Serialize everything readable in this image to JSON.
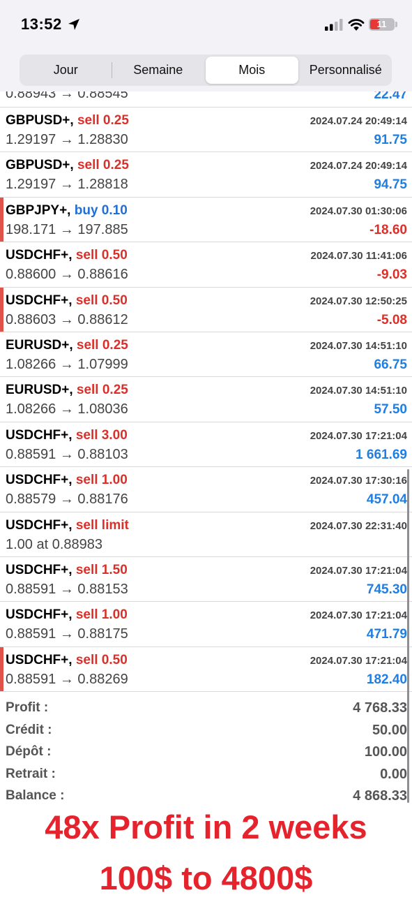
{
  "status_bar": {
    "time": "13:52",
    "battery": "11"
  },
  "tabs": [
    {
      "label": "Jour",
      "active": false
    },
    {
      "label": "Semaine",
      "active": false
    },
    {
      "label": "Mois",
      "active": true
    },
    {
      "label": "Personnalisé",
      "active": false
    }
  ],
  "first_row_partial": {
    "prices": "0.88943 → 0.88545",
    "profit": "22.47"
  },
  "trades": [
    {
      "symbol": "GBPUSD+,",
      "side": "sell 0.25",
      "side_type": "sell",
      "time": "2024.07.24 20:49:14",
      "prices": "1.29197 → 1.28830",
      "profit": "91.75",
      "profit_sign": "pos",
      "marker": false
    },
    {
      "symbol": "GBPUSD+,",
      "side": "sell 0.25",
      "side_type": "sell",
      "time": "2024.07.24 20:49:14",
      "prices": "1.29197 → 1.28818",
      "profit": "94.75",
      "profit_sign": "pos",
      "marker": false
    },
    {
      "symbol": "GBPJPY+,",
      "side": "buy 0.10",
      "side_type": "buy",
      "time": "2024.07.30 01:30:06",
      "prices": "198.171 → 197.885",
      "profit": "-18.60",
      "profit_sign": "neg",
      "marker": true
    },
    {
      "symbol": "USDCHF+,",
      "side": "sell 0.50",
      "side_type": "sell",
      "time": "2024.07.30 11:41:06",
      "prices": "0.88600 → 0.88616",
      "profit": "-9.03",
      "profit_sign": "neg",
      "marker": false
    },
    {
      "symbol": "USDCHF+,",
      "side": "sell 0.50",
      "side_type": "sell",
      "time": "2024.07.30 12:50:25",
      "prices": "0.88603 → 0.88612",
      "profit": "-5.08",
      "profit_sign": "neg",
      "marker": true
    },
    {
      "symbol": "EURUSD+,",
      "side": "sell 0.25",
      "side_type": "sell",
      "time": "2024.07.30 14:51:10",
      "prices": "1.08266 → 1.07999",
      "profit": "66.75",
      "profit_sign": "pos",
      "marker": false
    },
    {
      "symbol": "EURUSD+,",
      "side": "sell 0.25",
      "side_type": "sell",
      "time": "2024.07.30 14:51:10",
      "prices": "1.08266 → 1.08036",
      "profit": "57.50",
      "profit_sign": "pos",
      "marker": false
    },
    {
      "symbol": "USDCHF+,",
      "side": "sell 3.00",
      "side_type": "sell",
      "time": "2024.07.30 17:21:04",
      "prices": "0.88591 → 0.88103",
      "profit": "1 661.69",
      "profit_sign": "pos",
      "marker": false
    },
    {
      "symbol": "USDCHF+,",
      "side": "sell 1.00",
      "side_type": "sell",
      "time": "2024.07.30 17:30:16",
      "prices": "0.88579 → 0.88176",
      "profit": "457.04",
      "profit_sign": "pos",
      "marker": false
    },
    {
      "symbol": "USDCHF+,",
      "side": "sell limit",
      "side_type": "sell",
      "time": "2024.07.30 22:31:40",
      "prices": "1.00 at 0.88983",
      "profit": "",
      "profit_sign": "pos",
      "marker": false
    },
    {
      "symbol": "USDCHF+,",
      "side": "sell 1.50",
      "side_type": "sell",
      "time": "2024.07.30 17:21:04",
      "prices": "0.88591 → 0.88153",
      "profit": "745.30",
      "profit_sign": "pos",
      "marker": false
    },
    {
      "symbol": "USDCHF+,",
      "side": "sell 1.00",
      "side_type": "sell",
      "time": "2024.07.30 17:21:04",
      "prices": "0.88591 → 0.88175",
      "profit": "471.79",
      "profit_sign": "pos",
      "marker": false
    },
    {
      "symbol": "USDCHF+,",
      "side": "sell 0.50",
      "side_type": "sell",
      "time": "2024.07.30 17:21:04",
      "prices": "0.88591 → 0.88269",
      "profit": "182.40",
      "profit_sign": "pos",
      "marker": true
    }
  ],
  "summary": [
    {
      "label": "Profit :",
      "value": "4 768.33"
    },
    {
      "label": "Crédit :",
      "value": "50.00"
    },
    {
      "label": "Dépôt :",
      "value": "100.00"
    },
    {
      "label": "Retrait :",
      "value": "0.00"
    },
    {
      "label": "Balance :",
      "value": "4 868.33"
    }
  ],
  "promo": {
    "line1": "48x Profit in 2 weeks",
    "line2": "100$ to 4800$"
  },
  "colors": {
    "sell": "#d9302a",
    "buy": "#1f6fd6",
    "profit_pos": "#1f7ee0",
    "profit_neg": "#d9302a",
    "promo": "#e5232d",
    "marker": "#e0534a"
  },
  "icons": {
    "location": "location-arrow-icon",
    "signal": "cellular-signal-icon",
    "wifi": "wifi-icon",
    "battery": "battery-icon"
  }
}
